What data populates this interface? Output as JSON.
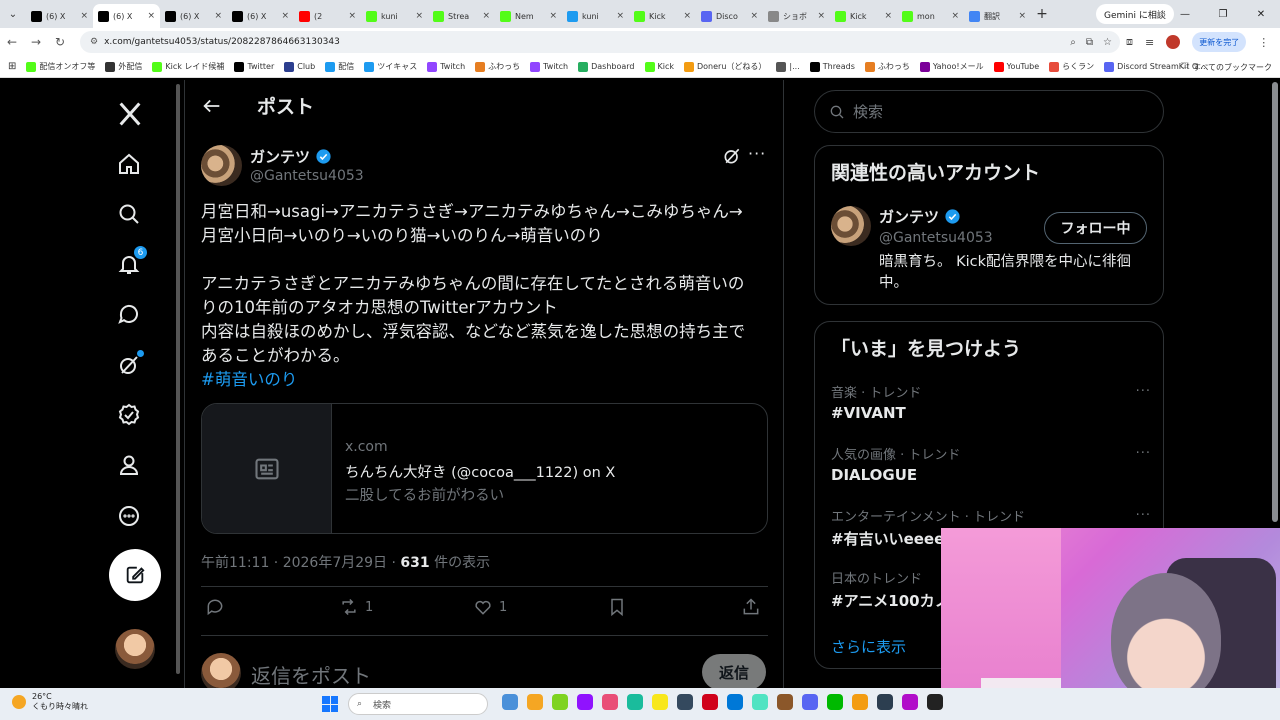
{
  "browser": {
    "tabs": [
      {
        "title": "(6) X",
        "active": false,
        "color": "#000000"
      },
      {
        "title": "(6) X",
        "active": true,
        "color": "#000000"
      },
      {
        "title": "(6) X",
        "active": false,
        "color": "#000000"
      },
      {
        "title": "(6) X",
        "active": false,
        "color": "#000000"
      },
      {
        "title": "(2",
        "active": false,
        "color": "#ff0000"
      },
      {
        "title": "kuni",
        "active": false,
        "color": "#53fc18"
      },
      {
        "title": "Strea",
        "active": false,
        "color": "#53fc18"
      },
      {
        "title": "Nem",
        "active": false,
        "color": "#53fc18"
      },
      {
        "title": "kuni",
        "active": false,
        "color": "#1d9bf0"
      },
      {
        "title": "Kick",
        "active": false,
        "color": "#53fc18"
      },
      {
        "title": "Disco",
        "active": false,
        "color": "#5865f2"
      },
      {
        "title": "ショボ",
        "active": false,
        "color": "#888888"
      },
      {
        "title": "Kick",
        "active": false,
        "color": "#53fc18"
      },
      {
        "title": "mon",
        "active": false,
        "color": "#53fc18"
      },
      {
        "title": "翻訳",
        "active": false,
        "color": "#4285f4"
      }
    ],
    "gemini_button": "Gemini に相談",
    "url": "x.com/gantetsu4053/status/2082287864663130343",
    "update_button": "更新を完了",
    "bookmarks": [
      {
        "label": "配信オンオフ等",
        "color": "#53fc18"
      },
      {
        "label": "外配信",
        "color": "#333333"
      },
      {
        "label": "Kick レイド候補",
        "color": "#53fc18"
      },
      {
        "label": "Twitter",
        "color": "#000000"
      },
      {
        "label": "Club",
        "color": "#2c3e8f"
      },
      {
        "label": "配信",
        "color": "#1d9bf0"
      },
      {
        "label": "ツイキャス",
        "color": "#1d9bf0"
      },
      {
        "label": "Twitch",
        "color": "#9146ff"
      },
      {
        "label": "ふわっち",
        "color": "#e67e22"
      },
      {
        "label": "Twitch",
        "color": "#9146ff"
      },
      {
        "label": "Dashboard",
        "color": "#27ae60"
      },
      {
        "label": "Kick",
        "color": "#53fc18"
      },
      {
        "label": "Doneru（どねる）",
        "color": "#f39c12"
      },
      {
        "label": "|...",
        "color": "#555555"
      },
      {
        "label": "Threads",
        "color": "#000000"
      },
      {
        "label": "ふわっち",
        "color": "#e67e22"
      },
      {
        "label": "Yahoo!メール",
        "color": "#7b0099"
      },
      {
        "label": "YouTube",
        "color": "#ff0000"
      },
      {
        "label": "らくラン",
        "color": "#e74c3c"
      },
      {
        "label": "Discord StreamKit O...",
        "color": "#5865f2"
      }
    ],
    "all_bookmarks": "すべてのブックマーク"
  },
  "nav": {
    "notification_count": "6"
  },
  "post": {
    "header_title": "ポスト",
    "author_name": "ガンテツ",
    "author_handle": "@Gantetsu4053",
    "body_lines": [
      "月宮日和→usagi→アニカテうさぎ→アニカテみゆちゃん→こみゆちゃん→",
      "月宮小日向→いのり→いのり猫→いのりん→萌音いのり",
      "",
      "アニカテうさぎとアニカテみゆちゃんの間に存在してたとされる萌音いの",
      "りの10年前のアタオカ思想のTwitterアカウント",
      "内容は自殺ほのめかし、浮気容認、などなど蒸気を逸した思想の持ち主で",
      "あることがわかる。"
    ],
    "hashtag": "#萌音いのり",
    "card": {
      "domain": "x.com",
      "title": "ちんちん大好き (@cocoa___1122) on X",
      "description": "二股してるお前がわるい"
    },
    "time": "午前11:11 · 2026年7月29日 · ",
    "views_count": "631",
    "views_label": " 件の表示",
    "retweets": "1",
    "likes": "1",
    "reply_placeholder": "返信をポスト",
    "reply_button": "返信"
  },
  "sidebar": {
    "search_placeholder": "検索",
    "related_title": "関連性の高いアカウント",
    "related": {
      "name": "ガンテツ",
      "handle": "@Gantetsu4053",
      "bio": "暗黒育ち。 Kick配信界隈を中心に徘徊中。",
      "follow_label": "フォロー中"
    },
    "trends_title": "「いま」を見つけよう",
    "trends": [
      {
        "category": "音楽 · トレンド",
        "name": "#VIVANT"
      },
      {
        "category": "人気の画像 · トレンド",
        "name": "DIALOGUE"
      },
      {
        "category": "エンターテインメント · トレンド",
        "name": "#有吉いいeeeee"
      },
      {
        "category": "日本のトレンド",
        "name": "#アニメ100カノ"
      }
    ],
    "show_more": "さらに表示"
  },
  "taskbar": {
    "temperature": "26°C",
    "weather": "くもり時々晴れ",
    "search_placeholder": "検索"
  }
}
